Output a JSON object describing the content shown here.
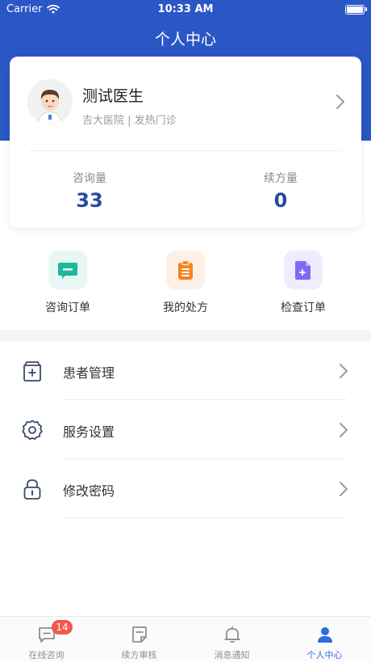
{
  "status_bar": {
    "carrier": "Carrier",
    "time": "10:33 AM"
  },
  "header": {
    "title": "个人中心"
  },
  "profile": {
    "name": "测试医生",
    "hospital": "吉大医院 | 发热门诊"
  },
  "stats": [
    {
      "label": "咨询量",
      "value": "33"
    },
    {
      "label": "续方量",
      "value": "0"
    }
  ],
  "quick_actions": [
    {
      "label": "咨询订单",
      "icon": "chat-bubble-icon",
      "color": "#1bb89c",
      "bg": "#e7f8f4"
    },
    {
      "label": "我的处方",
      "icon": "clipboard-icon",
      "color": "#f5841f",
      "bg": "#fdf0e6"
    },
    {
      "label": "检查订单",
      "icon": "document-plus-icon",
      "color": "#7b6cf2",
      "bg": "#eeecfd"
    }
  ],
  "menu": [
    {
      "label": "患者管理",
      "icon": "patient-folder-icon"
    },
    {
      "label": "服务设置",
      "icon": "gear-icon"
    },
    {
      "label": "修改密码",
      "icon": "lock-icon"
    }
  ],
  "tabbar": {
    "items": [
      {
        "label": "在线咨询",
        "icon": "chat-icon",
        "badge": "14"
      },
      {
        "label": "续方审核",
        "icon": "note-icon"
      },
      {
        "label": "消息通知",
        "icon": "bell-icon"
      },
      {
        "label": "个人中心",
        "icon": "person-icon"
      }
    ],
    "active_color": "#2a6fdb",
    "inactive_color": "#8e8e8e"
  },
  "colors": {
    "primary": "#2a56c6",
    "stat_value": "#274a9c",
    "badge": "#f2584c"
  }
}
